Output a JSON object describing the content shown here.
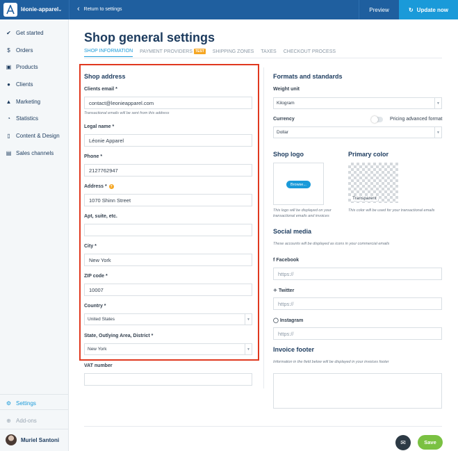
{
  "topbar": {
    "shop_name": "léonie-apparel",
    "return_label": "Return to settings",
    "preview_label": "Preview",
    "update_label": "Update now"
  },
  "sidebar": {
    "items": [
      {
        "label": "Get started",
        "icon": "check-circle-icon"
      },
      {
        "label": "Orders",
        "icon": "dollar-circle-icon"
      },
      {
        "label": "Products",
        "icon": "cart-icon"
      },
      {
        "label": "Clients",
        "icon": "users-icon"
      },
      {
        "label": "Marketing",
        "icon": "bell-icon"
      },
      {
        "label": "Statistics",
        "icon": "stats-icon"
      },
      {
        "label": "Content & Design",
        "icon": "mobile-icon"
      },
      {
        "label": "Sales channels",
        "icon": "store-icon"
      }
    ],
    "settings_label": "Settings",
    "addons_label": "Add-ons",
    "user_name": "Muriel Santoni"
  },
  "page": {
    "title": "Shop general settings",
    "tabs": [
      {
        "label": "SHOP INFORMATION",
        "active": true
      },
      {
        "label": "PAYMENT PROVIDERS",
        "badge": "TEST"
      },
      {
        "label": "SHIPPING ZONES"
      },
      {
        "label": "TAXES"
      },
      {
        "label": "CHECKOUT PROCESS"
      }
    ]
  },
  "shop_address": {
    "title": "Shop address",
    "clients_email": {
      "label": "Clients email *",
      "value": "contact@leonieapparel.com",
      "hint": "Transactional emails will be sent from this address"
    },
    "legal_name": {
      "label": "Legal name *",
      "value": "Léonie Apparel"
    },
    "phone": {
      "label": "Phone *",
      "value": "2127762947"
    },
    "address": {
      "label": "Address *",
      "value": "1070  Shinn Street"
    },
    "apt": {
      "label": "Apt, suite, etc.",
      "value": ""
    },
    "city": {
      "label": "City *",
      "value": "New York"
    },
    "zip": {
      "label": "ZIP code *",
      "value": "10007"
    },
    "country": {
      "label": "Country *",
      "value": "United States"
    },
    "state": {
      "label": "State, Outlying Area, District *",
      "value": "New York"
    },
    "vat": {
      "label": "VAT number",
      "value": ""
    }
  },
  "formats": {
    "title": "Formats and standards",
    "weight_label": "Weight unit",
    "weight_value": "Kilogram",
    "currency_label": "Currency",
    "pricing_advanced_label": "Pricing advanced format",
    "currency_value": "Dollar"
  },
  "shop_logo": {
    "title": "Shop logo",
    "browse_label": "Browse...",
    "hint": "This logo will be displayed on your transactional emails and invoices"
  },
  "primary_color": {
    "title": "Primary color",
    "value": "Transparent",
    "hint": "This color will be used for your transactional emails"
  },
  "social": {
    "title": "Social media",
    "hint": "These accounts will be displayed as icons in your commercial emails",
    "facebook_label": "Facebook",
    "facebook_placeholder": "https://",
    "twitter_label": "Twitter",
    "twitter_placeholder": "https://",
    "instagram_label": "Instagram",
    "instagram_placeholder": "https://"
  },
  "invoice": {
    "title": "Invoice footer",
    "hint": "Information in the field below will be displayed in your invoices footer"
  },
  "footer": {
    "save_label": "Save"
  },
  "colors": {
    "topbar": "#1f5f9f",
    "accent": "#1a9ad9",
    "highlight_border": "#e0381f",
    "save": "#7ac142",
    "badge": "#f5a623"
  }
}
